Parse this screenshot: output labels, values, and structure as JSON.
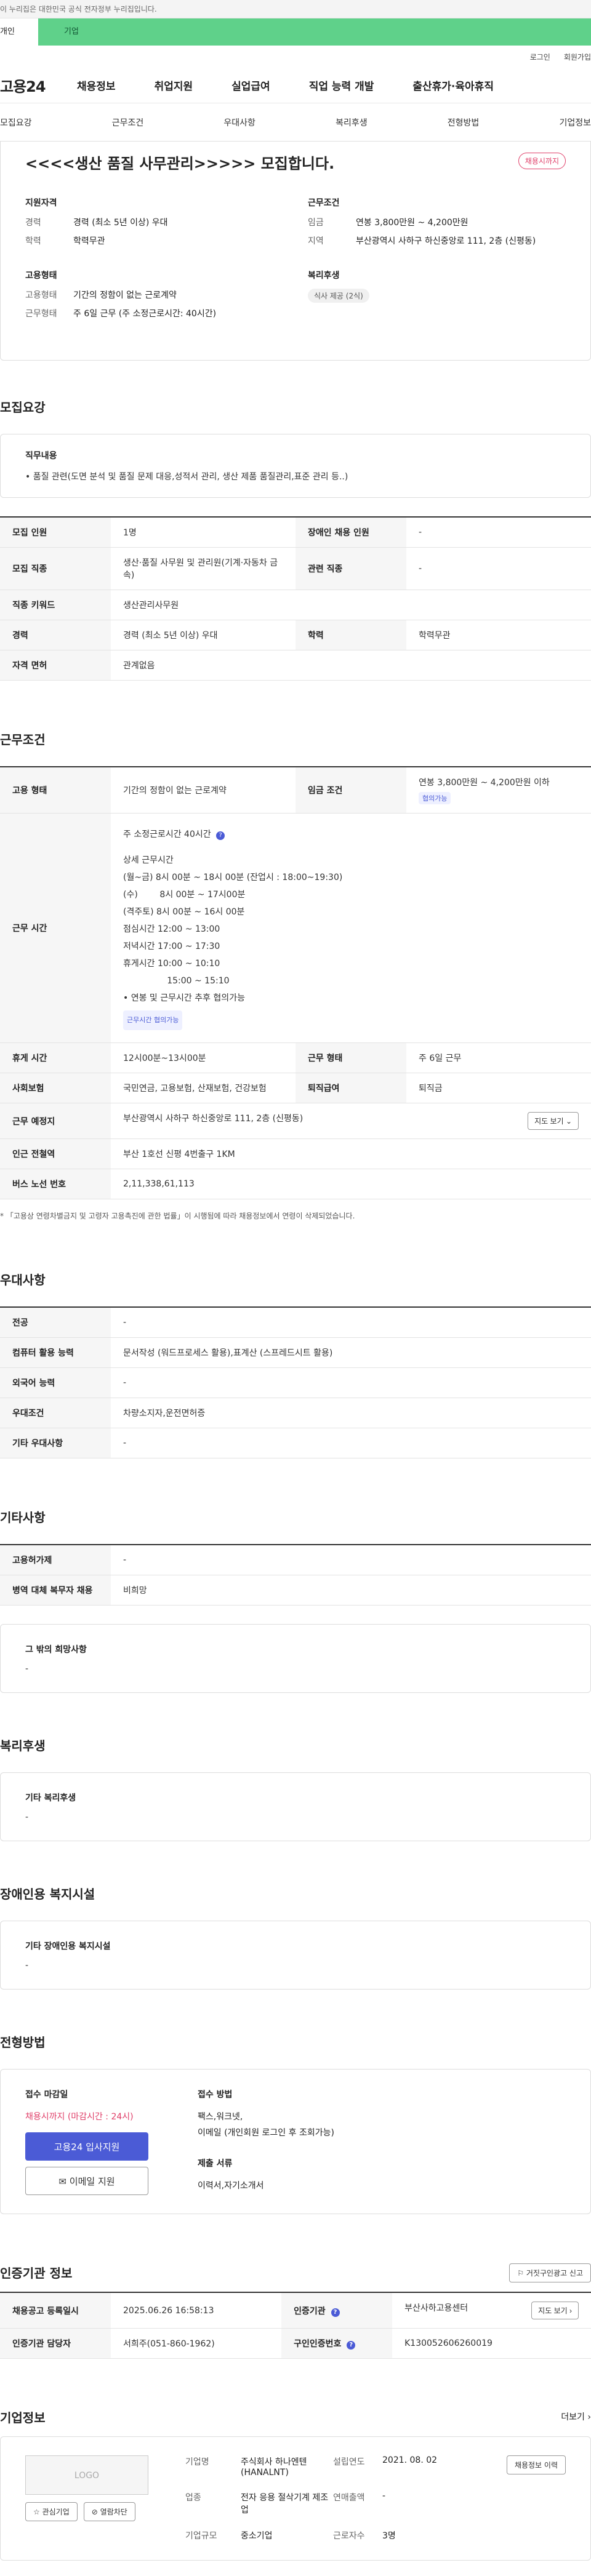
{
  "gov_banner": "이 누리집은 대한민국 공식 전자정부 누리집입니다.",
  "tabs": {
    "personal": "개인",
    "company": "기업"
  },
  "util": {
    "login": "로그인",
    "join": "회원가입"
  },
  "brand": {
    "logo": "고용24"
  },
  "gnb": [
    "채용정보",
    "취업지원",
    "실업급여",
    "직업 능력 개발",
    "출산휴가·육아휴직"
  ],
  "anchor_nav": [
    "모집요강",
    "근무조건",
    "우대사항",
    "복리후생",
    "전형방법",
    "기업정보"
  ],
  "summary": {
    "title": "<<<<생산 품질 사무관리>>>>> 모집합니다.",
    "deadline_badge": "채용시까지",
    "qualification": {
      "heading": "지원자격",
      "rows": [
        {
          "k": "경력",
          "v": "경력 (최소 5년 이상) 우대"
        },
        {
          "k": "학력",
          "v": "학력무관"
        }
      ]
    },
    "work_condition": {
      "heading": "근무조건",
      "rows": [
        {
          "k": "임금",
          "v": "연봉 3,800만원 ~ 4,200만원"
        },
        {
          "k": "지역",
          "v": "부산광역시 사하구 하신중앙로 111, 2층 (신평동)"
        }
      ]
    },
    "employment": {
      "heading": "고용형태",
      "rows": [
        {
          "k": "고용형태",
          "v": "기간의 정함이 없는 근로계약"
        },
        {
          "k": "근무형태",
          "v": "주 6일 근무 (주 소정근로시간: 40시간)"
        }
      ]
    },
    "welfare": {
      "heading": "복리후생",
      "pill": "식사 제공 (2식)"
    }
  },
  "recruit": {
    "title": "모집요강",
    "duty_heading": "직무내용",
    "duty_text": "• 품질 관련(도면 분석 및 품질 문제 대응,성적서 관리, 생산 제품 품질관리,표준 관리 등..)",
    "rows": [
      {
        "k1": "모집 인원",
        "v1": "1명",
        "k2": "장애인 채용 인원",
        "v2": "-"
      },
      {
        "k1": "모집 직종",
        "v1": "생산·품질 사무원 및 관리원(기계·자동차 금속)",
        "k2": "관련 직종",
        "v2": "-"
      },
      {
        "k1": "직종 키워드",
        "v1": "생산관리사무원"
      },
      {
        "k1": "경력",
        "v1": "경력 (최소 5년 이상) 우대",
        "k2": "학력",
        "v2": "학력무관"
      },
      {
        "k1": "자격 면허",
        "v1": "관계없음"
      }
    ]
  },
  "conditions": {
    "title": "근무조건",
    "employment_k": "고용 형태",
    "employment_v": "기간의 정함이 없는 근로계약",
    "wage_k": "임금 조건",
    "wage_v": "연봉 3,800만원 ~ 4,200만원 이하",
    "wage_pill": "협의가능",
    "hours_k": "근무 시간",
    "hours_lines": [
      "주 소정근로시간 40시간",
      "",
      "상세 근무시간",
      "(월~금) 8시 00분 ~ 18시 00분 (잔업시 : 18:00~19:30)",
      "(수)        8시 00분 ~ 17시00분",
      "(격주토) 8시 00분 ~ 16시 00분",
      "점심시간 12:00 ~ 13:00",
      "저녁시간 17:00 ~ 17:30",
      "휴게시간 10:00 ~ 10:10",
      "                15:00 ~ 15:10",
      "• 연봉 및 근무시간 추후 협의가능"
    ],
    "hours_pill": "근무시간 협의가능",
    "rest_k": "휴게 시간",
    "rest_v": "12시00분~13시00분",
    "worktype_k": "근무 형태",
    "worktype_v": "주 6일 근무",
    "insurance_k": "사회보험",
    "insurance_v": "국민연금, 고용보험, 산재보험, 건강보험",
    "severance_k": "퇴직급여",
    "severance_v": "퇴직금",
    "location_k": "근무 예정지",
    "location_v": "부산광역시 사하구 하신중앙로 111, 2층 (신평동)",
    "map_btn": "지도 보기",
    "subway_k": "인근 전철역",
    "subway_v": "부산 1호선 신평 4번출구 1KM",
    "bus_k": "버스 노선 번호",
    "bus_v": "2,11,338,61,113",
    "note": "* 「고용상 연령차별금지 및 고령자 고용촉진에 관한 법률」이 시행됨에 따라 채용정보에서 연령이 삭제되었습니다."
  },
  "preference": {
    "title": "우대사항",
    "rows": [
      {
        "k": "전공",
        "v": "-"
      },
      {
        "k": "컴퓨터 활용 능력",
        "v": "문서작성 (워드프로세스 활용),표계산 (스프레드시트 활용)"
      },
      {
        "k": "외국어 능력",
        "v": "-"
      },
      {
        "k": "우대조건",
        "v": "차량소지자,운전면허증"
      },
      {
        "k": "기타 우대사항",
        "v": "-"
      }
    ]
  },
  "etc": {
    "title": "기타사항",
    "rows": [
      {
        "k": "고용허가제",
        "v": "-"
      },
      {
        "k": "병역 대체 복무자 채용",
        "v": "비희망"
      }
    ],
    "box_heading": "그 밖의 희망사항",
    "box_text": "-"
  },
  "welfare": {
    "title": "복리후생",
    "heading": "기타 복리후생",
    "text": "-"
  },
  "disability": {
    "title": "장애인용 복지시설",
    "heading": "기타 장애인용 복지시설",
    "text": "-"
  },
  "selection": {
    "title": "전형방법",
    "deadline_heading": "접수 마감일",
    "deadline": "채용시까지 (마감시간 : 24시)",
    "apply_btn": "고용24 입사지원",
    "email_btn": "이메일 지원",
    "method_heading": "접수 방법",
    "method_lines": [
      "팩스,워크넷,",
      "이메일 (개인회원 로그인 후 조회가능)"
    ],
    "docs_heading": "제출 서류",
    "docs": "이력서,자기소개서"
  },
  "certification": {
    "title": "인증기관 정보",
    "report_btn": "거짓구인광고 신고",
    "rows": [
      {
        "k1": "채용공고 등록일시",
        "v1": "2025.06.26 16:58:13",
        "k2": "인증기관",
        "v2": "부산사하고용센터",
        "btn": "지도 보기"
      },
      {
        "k1": "인증기관 담당자",
        "v1": "서희주(051-860-1962)",
        "k2": "구인인증번호",
        "v2": "K130052606260019"
      }
    ]
  },
  "company": {
    "title": "기업정보",
    "more": "더보기",
    "logo": "LOGO",
    "fav_btn": "관심기업",
    "block_btn": "열람차단",
    "history_btn": "채용정보 이력",
    "fields": [
      {
        "k": "기업명",
        "v": "주식회사 하나엔텐 (HANALNT)"
      },
      {
        "k": "설립연도",
        "v": "2021. 08. 02"
      },
      {
        "k": "업종",
        "v": "전자 응용 절삭기계 제조업"
      },
      {
        "k": "연매출액",
        "v": "-"
      },
      {
        "k": "기업규모",
        "v": "중소기업"
      },
      {
        "k": "근로자수",
        "v": "3명"
      }
    ]
  }
}
